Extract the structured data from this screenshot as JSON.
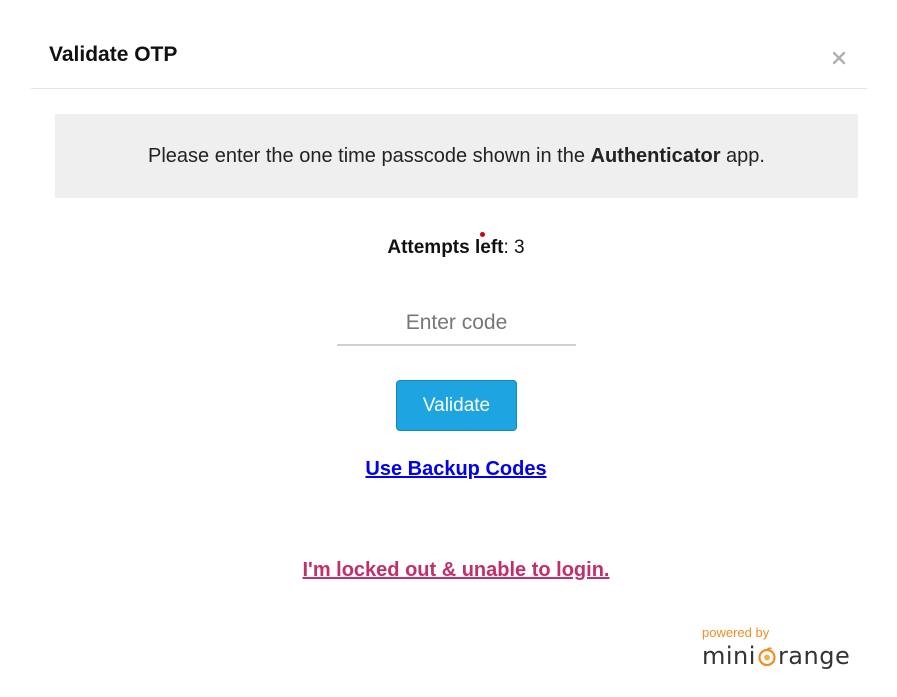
{
  "dialog": {
    "title": "Validate OTP",
    "close_icon": "close-icon"
  },
  "info": {
    "prefix": "Please enter the one time passcode shown in the ",
    "app_name": "Authenticator",
    "suffix": " app."
  },
  "attempts": {
    "label": "Attempts left",
    "separator": ": ",
    "count": "3"
  },
  "code_input": {
    "placeholder": "Enter code",
    "value": ""
  },
  "validate_button": {
    "label": "Validate"
  },
  "links": {
    "backup_codes": "Use Backup Codes",
    "locked_out": "I'm locked out & unable to login."
  },
  "branding": {
    "powered_by": "powered by",
    "brand_prefix": "mini",
    "brand_suffix": "range",
    "logo_icon": "orange-logo-icon"
  },
  "colors": {
    "button": "#1ea4e0",
    "backup_link": "#0000ee",
    "locked_link": "#c0306a",
    "brand_orange": "#f28c28",
    "info_bg": "#efefef"
  }
}
